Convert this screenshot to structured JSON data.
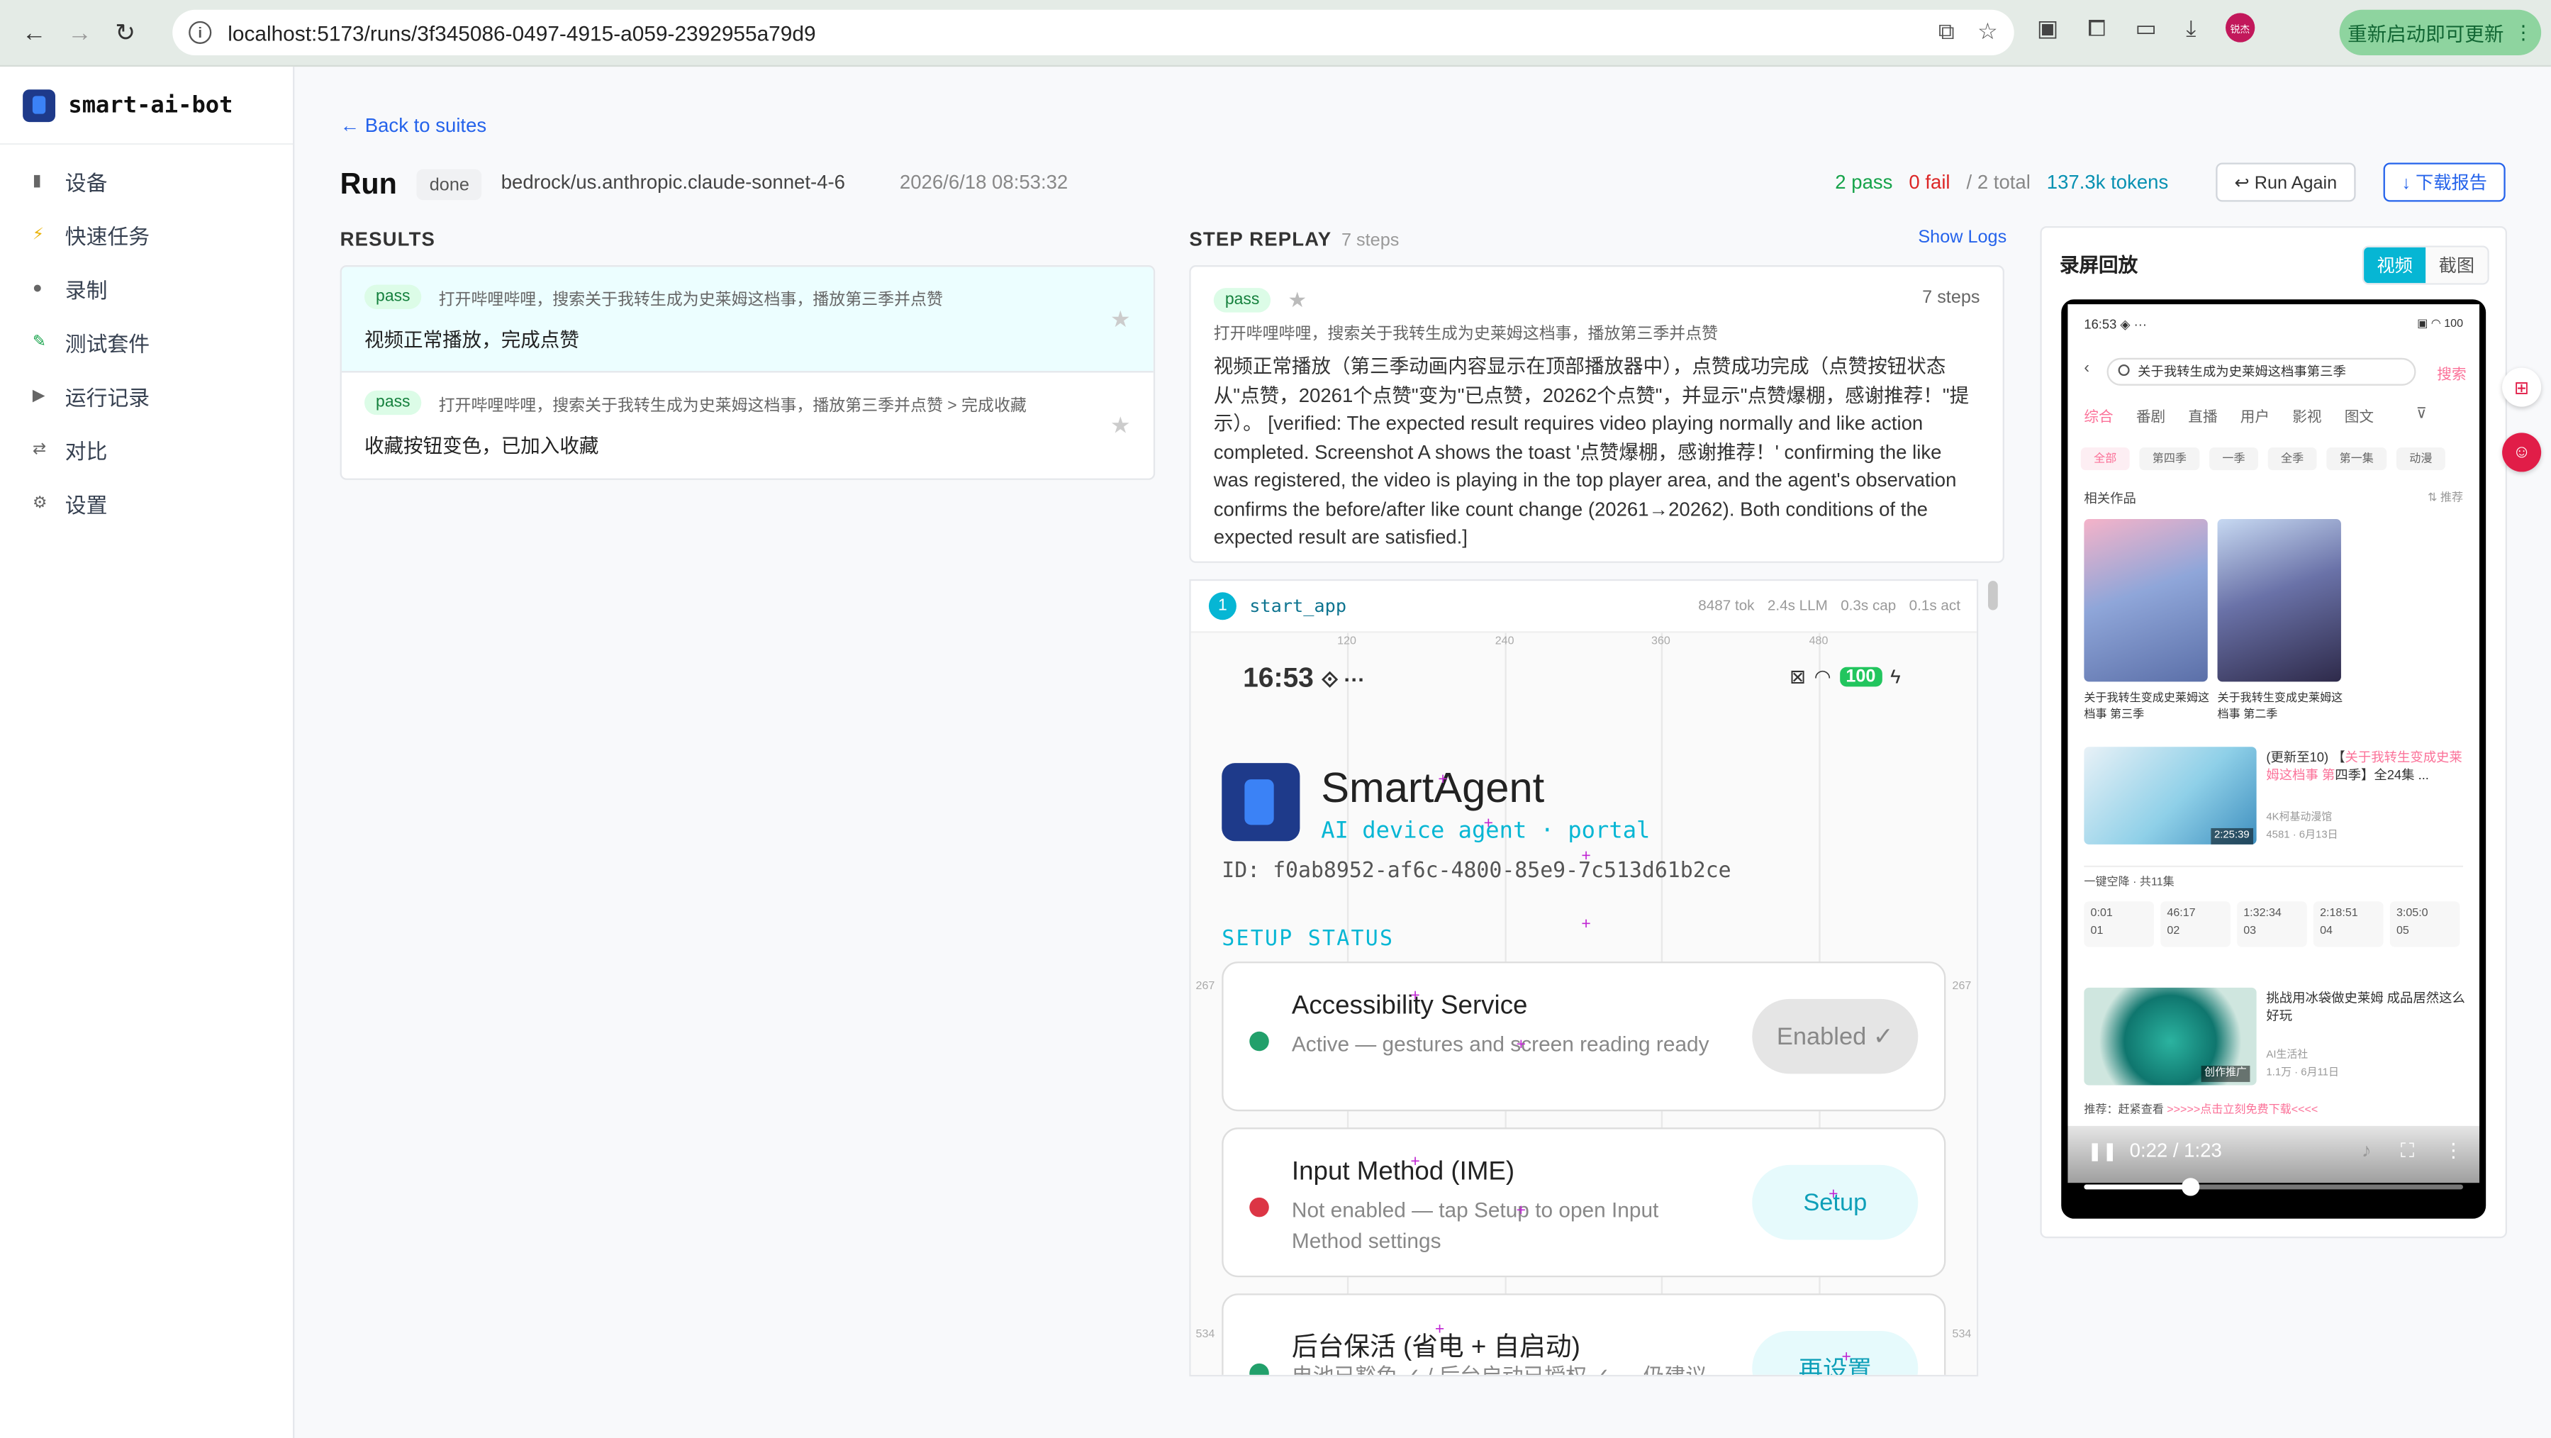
{
  "browser": {
    "url": "localhost:5173/runs/3f345086-0497-4915-a059-2392955a79d9",
    "update_label": "重新启动即可更新",
    "avatar_label": "锐杰"
  },
  "sidebar": {
    "brand": "smart-ai-bot",
    "items": [
      {
        "label": "设备",
        "icon": "▮"
      },
      {
        "label": "快速任务",
        "icon": "⚡"
      },
      {
        "label": "录制",
        "icon": "●"
      },
      {
        "label": "测试套件",
        "icon": "✎"
      },
      {
        "label": "运行记录",
        "icon": "▶"
      },
      {
        "label": "对比",
        "icon": "⇄"
      },
      {
        "label": "设置",
        "icon": "⚙"
      }
    ]
  },
  "header": {
    "back": "← Back to suites",
    "title": "Run",
    "status": "done",
    "model": "bedrock/us.anthropic.claude-sonnet-4-6",
    "timestamp": "2026/6/18 08:53:32",
    "pass": "2 pass",
    "fail": "0 fail",
    "total": "/ 2 total",
    "tokens": "137.3k tokens",
    "run_again": "↩ Run Again",
    "download": "↓ 下载报告"
  },
  "results": {
    "heading": "RESULTS",
    "items": [
      {
        "status": "pass",
        "query": "打开哔哩哔哩，搜索关于我转生成为史莱姆这档事，播放第三季并点赞",
        "answer": "视频正常播放，完成点赞"
      },
      {
        "status": "pass",
        "query": "打开哔哩哔哩，搜索关于我转生成为史莱姆这档事，播放第三季并点赞 > 完成收藏",
        "answer": "收藏按钮变色，已加入收藏"
      }
    ]
  },
  "replay": {
    "heading": "STEP REPLAY",
    "steps_count": "7 steps",
    "show_logs": "Show Logs",
    "status": "pass",
    "steps_right": "7 steps",
    "query": "打开哔哩哔哩，搜索关于我转生成为史莱姆这档事，播放第三季并点赞",
    "body": "视频正常播放（第三季动画内容显示在顶部播放器中），点赞成功完成（点赞按钮状态从\"点赞，20261个点赞\"变为\"已点赞，20262个点赞\"，并显示\"点赞爆棚，感谢推荐！\"提示）。 [verified: The expected result requires video playing normally and like action completed. Screenshot A shows the toast '点赞爆棚，感谢推荐！' confirming the like was registered, the video is playing in the top player area, and the agent's observation confirms the before/after like count change (20261→20262). Both conditions of the expected result are satisfied.]",
    "step": {
      "num": "1",
      "name": "start_app",
      "tok": "8487 tok",
      "llm": "2.4s LLM",
      "cap": "0.3s cap",
      "act": "0.1s act"
    },
    "shot": {
      "time": "16:53",
      "battery": "100",
      "app_name": "SmartAgent",
      "app_sub": "AI device agent · portal",
      "device_id": "ID: f0ab8952-af6c-4800-85e9-7c513d61b2ce",
      "setup": "SETUP STATUS",
      "grid_labels": [
        "120",
        "240",
        "360",
        "480"
      ],
      "row_labels": [
        "267",
        "267",
        "534",
        "534"
      ],
      "cards": [
        {
          "title": "Accessibility Service",
          "desc": "Active — gestures and screen reading ready",
          "button": "Enabled ✓",
          "dot": "#22a06b",
          "btn_bg": "#e5e5e5",
          "btn_fg": "#888"
        },
        {
          "title": "Input Method (IME)",
          "desc": "Not enabled — tap Setup to open Input Method settings",
          "button": "Setup",
          "dot": "#dc3545",
          "btn_bg": "#e6fafc",
          "btn_fg": "#0e9fb8"
        },
        {
          "title": "后台保活 (省电 + 自启动)",
          "desc": "电池已豁免 ✓ / 后台启动已授权 ✓ — 仍建议",
          "button": "再设置",
          "dot": "#22a06b",
          "btn_bg": "#e6fafc",
          "btn_fg": "#0e9fb8"
        }
      ]
    }
  },
  "recording": {
    "title": "录屏回放",
    "tab_video": "视频",
    "tab_shot": "截图",
    "phone": {
      "time": "16:53 ◈ ···",
      "status_right": "▣ ◠ 100",
      "search": "关于我转生成为史莱姆这档事第三季",
      "search_btn": "搜索",
      "tabs": [
        "综合",
        "番剧",
        "直播",
        "用户",
        "影视",
        "图文"
      ],
      "chips": [
        "全部",
        "第四季",
        "一季",
        "全季",
        "第一集",
        "动漫"
      ],
      "related": "相关作品",
      "related_right": "⇅ 推荐",
      "works": [
        {
          "caption": "关于我转生变成史莱姆这档事 第三季"
        },
        {
          "caption": "关于我转生变成史莱姆这档事 第二季"
        }
      ],
      "item1_title_a": "(更新至10) 【",
      "item1_title_hl": "关于我转生变成史莱姆这档事 第",
      "item1_title_b": "四季】全24集 ...",
      "item1_meta1": "4K柯基动漫馆",
      "item1_meta2": "4581 · 6月13日",
      "item1_dur": "2:25:39",
      "eps_header": "一键空降 · 共11集",
      "eps": [
        {
          "t": "0:01",
          "n": "01"
        },
        {
          "t": "46:17",
          "n": "02"
        },
        {
          "t": "1:32:34",
          "n": "03"
        },
        {
          "t": "2:18:51",
          "n": "04"
        },
        {
          "t": "3:05:0",
          "n": "05"
        }
      ],
      "item2_title": "挑战用冰袋做史莱姆 成品居然这么好玩",
      "item2_meta1": "AI生活社",
      "item2_meta2": "1.1万 · 6月11日",
      "item2_badge": "创作推广",
      "rec_a": "推荐：赶紧查看",
      "rec_b": ">>>>>点击立刻免费下载<<<<",
      "playback": "0:22 / 1:23",
      "progress": 0.28
    }
  }
}
